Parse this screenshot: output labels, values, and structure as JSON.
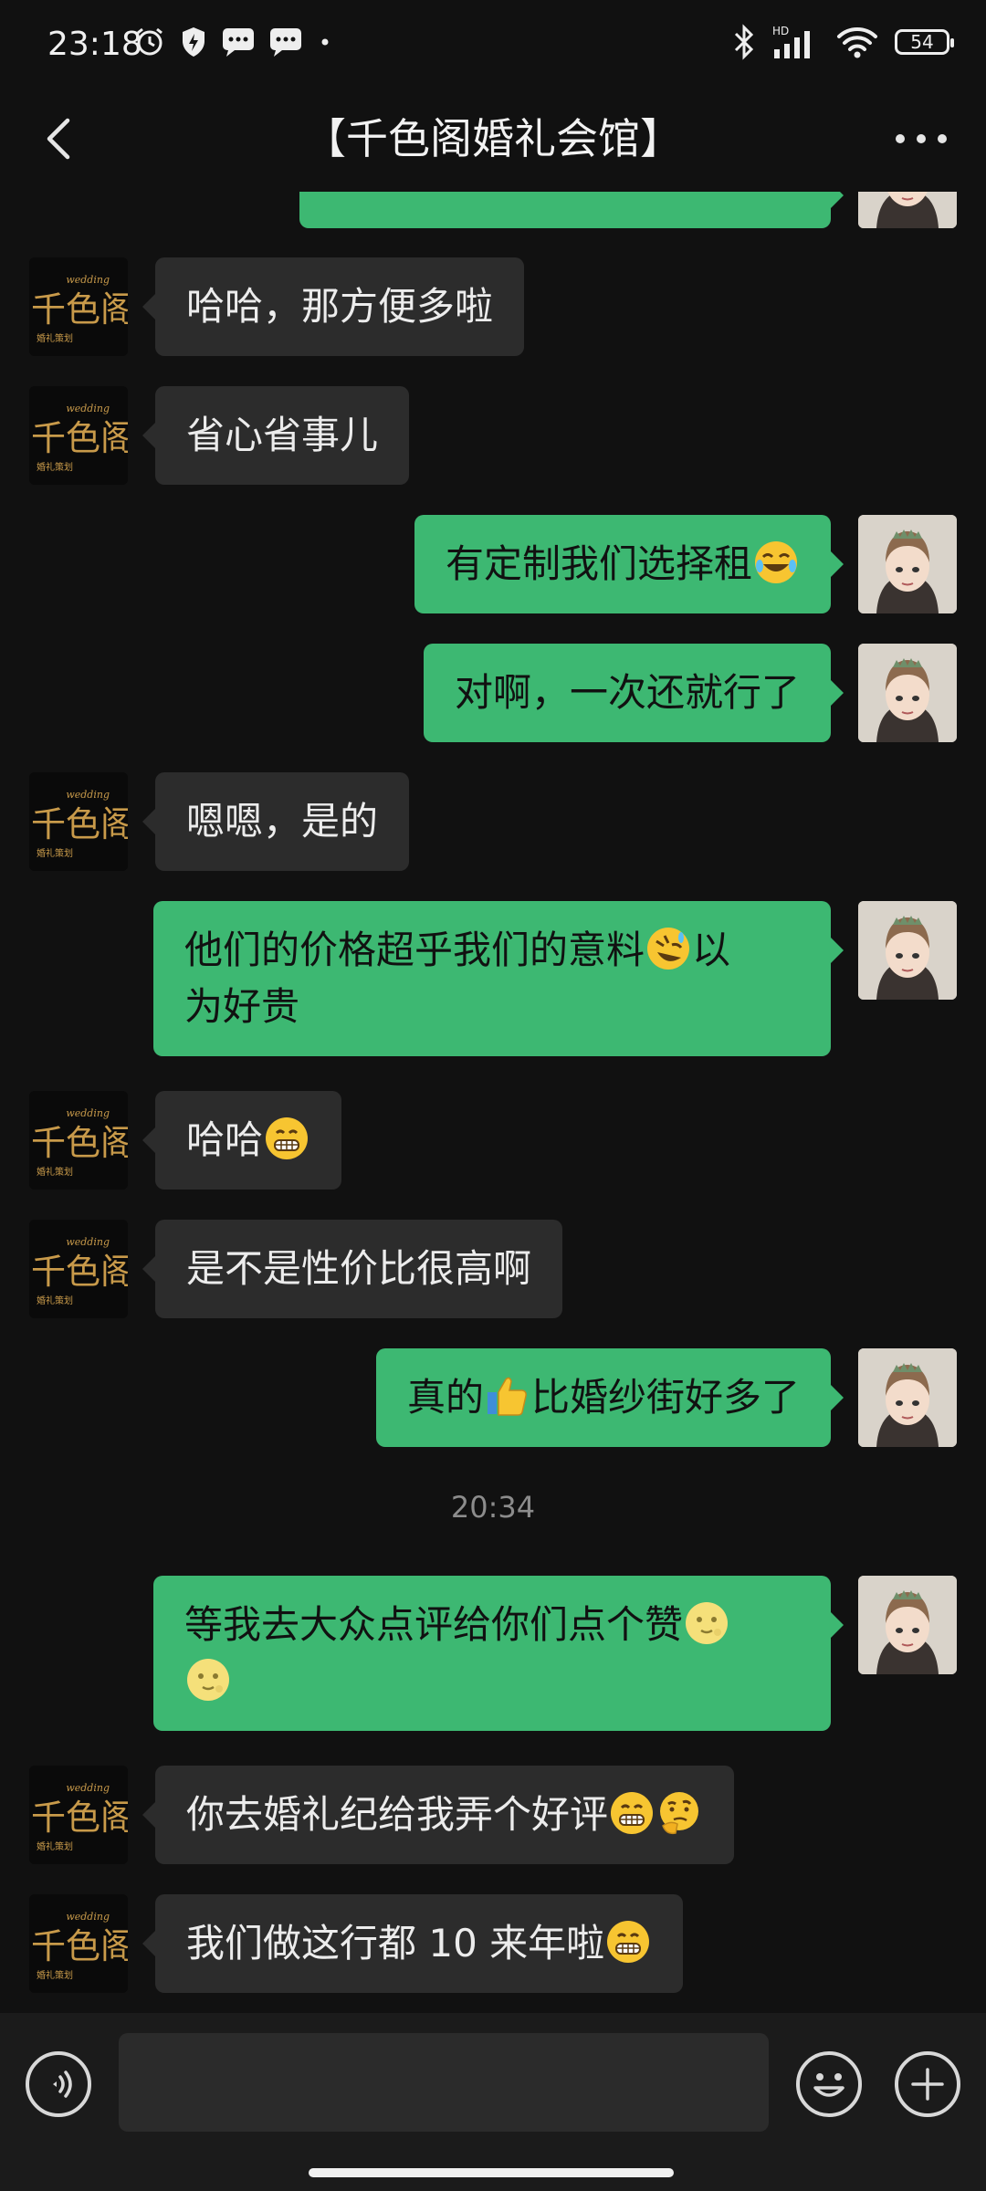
{
  "status_bar": {
    "time": "23:18",
    "battery": "54",
    "left_icons": [
      "alarm-icon",
      "shield-icon",
      "message-icon",
      "message-icon",
      "dot-icon"
    ],
    "right_icons": [
      "bluetooth-icon",
      "signal-hd-icon",
      "wifi-icon",
      "battery-icon"
    ]
  },
  "header": {
    "title": "【千色阁婚礼会馆】",
    "back_icon": "chevron-left-icon",
    "more_icon": "more-dots-icon"
  },
  "shop_avatar": {
    "logo_text": "千色阁",
    "logo_sub": "wedding",
    "logo_small": "婚礼策划"
  },
  "colors": {
    "background": "#111111",
    "incoming_bubble": "#2c2c2c",
    "outgoing_bubble": "#3db872",
    "logo_gold": "#c89a4a",
    "timestamp": "#8c8c8c"
  },
  "messages": [
    {
      "side": "out",
      "text": "",
      "partial": true
    },
    {
      "side": "in",
      "text": "哈哈，那方便多啦"
    },
    {
      "side": "in",
      "text": "省心省事儿"
    },
    {
      "side": "out",
      "text": "有定制我们选择租",
      "emoji_after": "laugh-tears-emoji"
    },
    {
      "side": "out",
      "text": "对啊，一次还就行了"
    },
    {
      "side": "in",
      "text": "嗯嗯，是的"
    },
    {
      "side": "out",
      "text_line1": "他们的价格超乎我们的意料",
      "text_line1_tail": "以",
      "text_line2": "为好贵",
      "emoji_mid": "rolling-laugh-emoji"
    },
    {
      "side": "in",
      "text": "哈哈",
      "emoji_after": "grin-emoji"
    },
    {
      "side": "in",
      "text": "是不是性价比很高啊"
    },
    {
      "side": "out",
      "text_pre": "真的",
      "emoji_mid": "thumbs-up-emoji",
      "text_post": "比婚纱街好多了"
    },
    {
      "side": "time",
      "text": "20:34"
    },
    {
      "side": "out",
      "text_line1": "等我去大众点评给你们点个赞",
      "emoji_line1": "moon-face-emoji",
      "emoji_line2": "moon-face-emoji"
    },
    {
      "side": "in",
      "text": "你去婚礼纪给我弄个好评",
      "emoji_after": "grin-emoji",
      "emoji_after2": "thinking-emoji"
    },
    {
      "side": "in",
      "text": "我们做这行都 10 来年啦",
      "emoji_after": "grin-emoji"
    }
  ],
  "input_bar": {
    "voice_icon": "voice-icon",
    "emoji_icon": "emoji-smile-icon",
    "plus_icon": "plus-icon",
    "placeholder": ""
  }
}
